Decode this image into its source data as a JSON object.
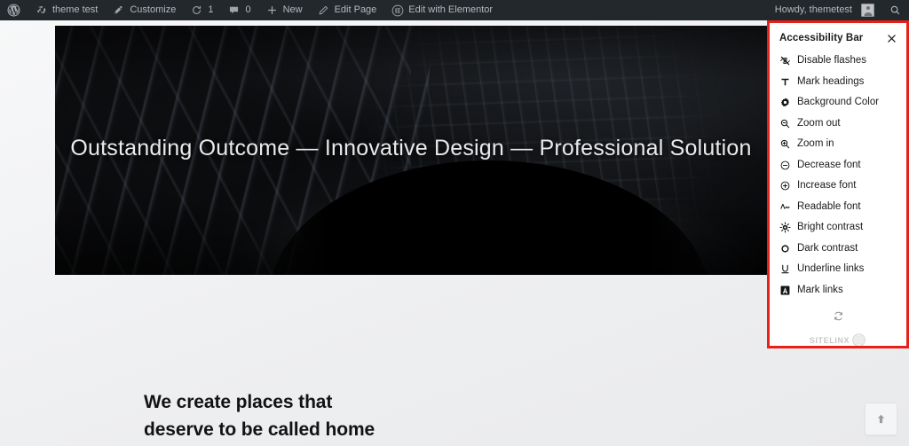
{
  "adminbar": {
    "wp_logo_icon": "wordpress-logo-icon",
    "items": [
      {
        "icon": "dashboard-home-icon",
        "label": "theme test"
      },
      {
        "icon": "pencil-customize-icon",
        "label": "Customize"
      },
      {
        "icon": "updates-icon",
        "label": "1"
      },
      {
        "icon": "comment-bubble-icon",
        "label": "0"
      },
      {
        "icon": "plus-icon",
        "label": "New"
      },
      {
        "icon": "pencil-edit-icon",
        "label": "Edit Page"
      },
      {
        "icon": "elementor-icon",
        "label": "Edit with Elementor"
      }
    ],
    "howdy": "Howdy, themetest",
    "avatar_icon": "user-avatar",
    "search_icon": "search-icon",
    "bar_bg": "#23282d",
    "text_color": "#b4b9be"
  },
  "hero": {
    "heading": "Outstanding Outcome — Innovative Design — Professional Solution"
  },
  "content": {
    "tagline_line1": "We create places that",
    "tagline_line2": "deserve to be called home"
  },
  "scroll_top": {
    "icon": "arrow-up-icon",
    "title": "Scroll to top"
  },
  "accessibility_panel": {
    "title": "Accessibility Bar",
    "close_icon": "close-x-icon",
    "border_color": "#e8201a",
    "items": [
      {
        "icon": "eye-slash-icon",
        "label": "Disable flashes"
      },
      {
        "icon": "text-heading-icon",
        "label": "Mark headings"
      },
      {
        "icon": "gear-icon",
        "label": "Background Color"
      },
      {
        "icon": "zoom-out-icon",
        "label": "Zoom out"
      },
      {
        "icon": "zoom-in-icon",
        "label": "Zoom in"
      },
      {
        "icon": "minus-circle-icon",
        "label": "Decrease font"
      },
      {
        "icon": "plus-circle-icon",
        "label": "Increase font"
      },
      {
        "icon": "wave-font-icon",
        "label": "Readable font"
      },
      {
        "icon": "sun-contrast-icon",
        "label": "Bright contrast"
      },
      {
        "icon": "moon-contrast-icon",
        "label": "Dark contrast"
      },
      {
        "icon": "underline-u-icon",
        "label": "Underline links"
      },
      {
        "icon": "mark-links-a-icon",
        "label": "Mark links"
      }
    ],
    "reset_icon": "reset-refresh-icon",
    "brand_name": "SITELINX",
    "brand_mark_icon": "sitelinx-globe-icon"
  }
}
